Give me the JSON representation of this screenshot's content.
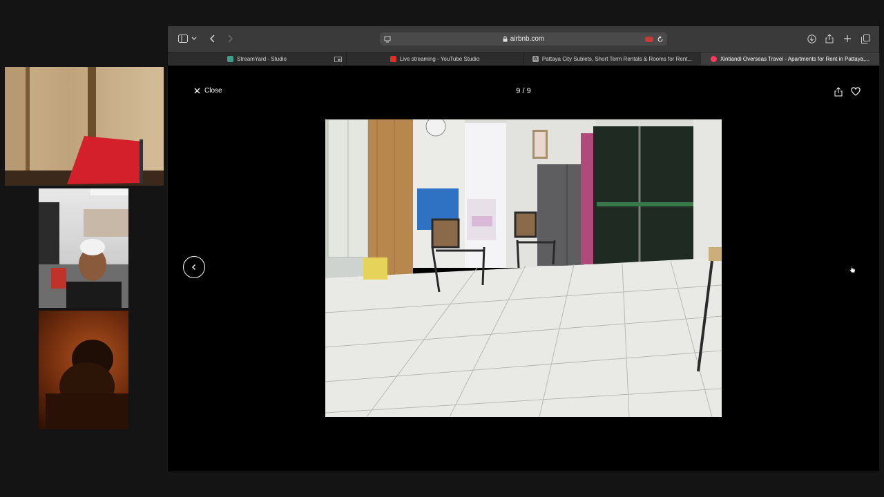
{
  "browser": {
    "url": "airbnb.com",
    "tabs": [
      {
        "label": "StreamYard - Studio",
        "icon_color": "#3aa08a",
        "active": false
      },
      {
        "label": "Live streaming - YouTube Studio",
        "icon_color": "#e52d27",
        "active": false
      },
      {
        "label": "Pattaya City Sublets, Short Term Rentals & Rooms for Rent...",
        "icon_color": "#9a9a9a",
        "icon_letter": "A",
        "active": false
      },
      {
        "label": "Xintiandi Overseas Travel - Apartments for Rent in Pattaya,...",
        "icon_color": "#ff385c",
        "active": true
      }
    ]
  },
  "viewer": {
    "close_label": "Close",
    "counter": "9 / 9"
  },
  "icons": {
    "sidebar": "sidebar-icon",
    "back": "chevron-left-icon",
    "forward": "chevron-right-icon",
    "download": "download-icon",
    "share": "share-icon",
    "new_tab": "plus-icon",
    "tabs_overview": "tabs-overview-icon",
    "lock": "lock-icon",
    "reload": "reload-icon",
    "heart": "heart-icon"
  }
}
